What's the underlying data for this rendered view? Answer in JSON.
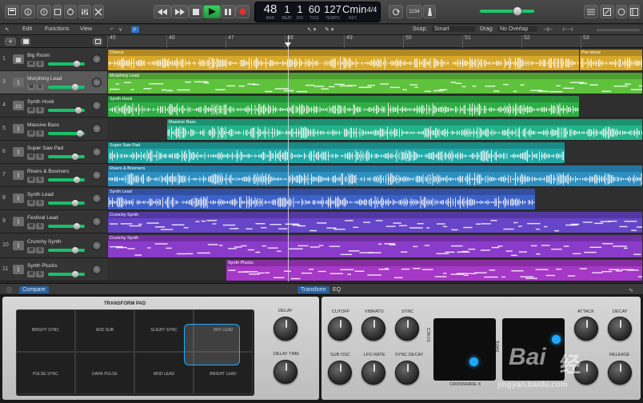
{
  "transport": {
    "bar": "48",
    "beat": "1",
    "div": "1",
    "tick": "60",
    "tempo": "127",
    "key": "Cmin",
    "signature": "4/4",
    "bar_label": "BAR",
    "beat_label": "BEAT",
    "div_label": "DIV",
    "tick_label": "TICK",
    "tempo_label": "TEMPO",
    "key_label": "KEY",
    "sig_label": "",
    "count_in": "1234"
  },
  "track_menu": {
    "edit": "Edit",
    "functions": "Functions",
    "view": "View"
  },
  "toolbar": {
    "snap_label": "Snap:",
    "snap_value": "Smart",
    "drag_label": "Drag:",
    "drag_value": "No Overlap"
  },
  "ruler": {
    "bars": [
      "45",
      "46",
      "47",
      "48",
      "49",
      "50",
      "51",
      "52",
      "53"
    ]
  },
  "tracks": [
    {
      "num": "1",
      "name": "Big Room"
    },
    {
      "num": "3",
      "name": "Morphing Lead"
    },
    {
      "num": "4",
      "name": "Synth Hook"
    },
    {
      "num": "5",
      "name": "Massive Bass"
    },
    {
      "num": "6",
      "name": "Super Saw Pad"
    },
    {
      "num": "7",
      "name": "Risers & Boomers"
    },
    {
      "num": "8",
      "name": "Synth Lead"
    },
    {
      "num": "9",
      "name": "Festival Lead"
    },
    {
      "num": "10",
      "name": "Crunchy Synth"
    },
    {
      "num": "11",
      "name": "Synth Plucks"
    }
  ],
  "m_label": "M",
  "s_label": "S",
  "regions": [
    {
      "label": "Chorus",
      "color": "#d9a92b"
    },
    {
      "label": "Pre-verse",
      "color": "#d9a92b"
    },
    {
      "label": "Morphing Lead",
      "color": "#5fc23c"
    },
    {
      "label": "Synth Hook",
      "color": "#2fae45"
    },
    {
      "label": "Massive Bass",
      "color": "#23b38a"
    },
    {
      "label": "Super Saw Pad",
      "color": "#1fa9a7"
    },
    {
      "label": "Risers & Boomers",
      "color": "#2d8fc0"
    },
    {
      "label": "Synth Lead",
      "color": "#3c62c9"
    },
    {
      "label": "Crunchy Synth",
      "color": "#6645c8"
    },
    {
      "label": "Crunchy Synth",
      "color": "#8b3bc9"
    },
    {
      "label": "Synth Plucks",
      "color": "#a538c6"
    }
  ],
  "editor": {
    "compare": "Compare",
    "transform": "Transform",
    "eq": "EQ"
  },
  "transform_pad": {
    "title": "TRANSFORM PAD",
    "cells": [
      "BRIGHT SYNC",
      "ADD SUB",
      "SLIGHT SYNC",
      "DRY LEAD",
      "PULSE SYNC",
      "DARK PULSE",
      "MOD LEAD",
      "BRIGHT LEAD"
    ]
  },
  "knobs_left": {
    "delay": "DELAY",
    "delay_time": "DELAY TIME"
  },
  "knobs_right": {
    "cutoff": "CUTOFF",
    "vibrato": "VIBRATO",
    "sync": "SYNC",
    "sub_osc": "SUB OSC",
    "lfo_rate": "LFO RATE",
    "sync_decay": "SYNC DECAY",
    "attack": "ATTACK",
    "decay": "DECAY",
    "release": "RELEASE",
    "sync2": "SYNC2",
    "crossfade": "CROSSFADE X",
    "rate": "RATE"
  },
  "watermark": {
    "logo": "Bai",
    "sub": "jingyan.baidu.com"
  }
}
